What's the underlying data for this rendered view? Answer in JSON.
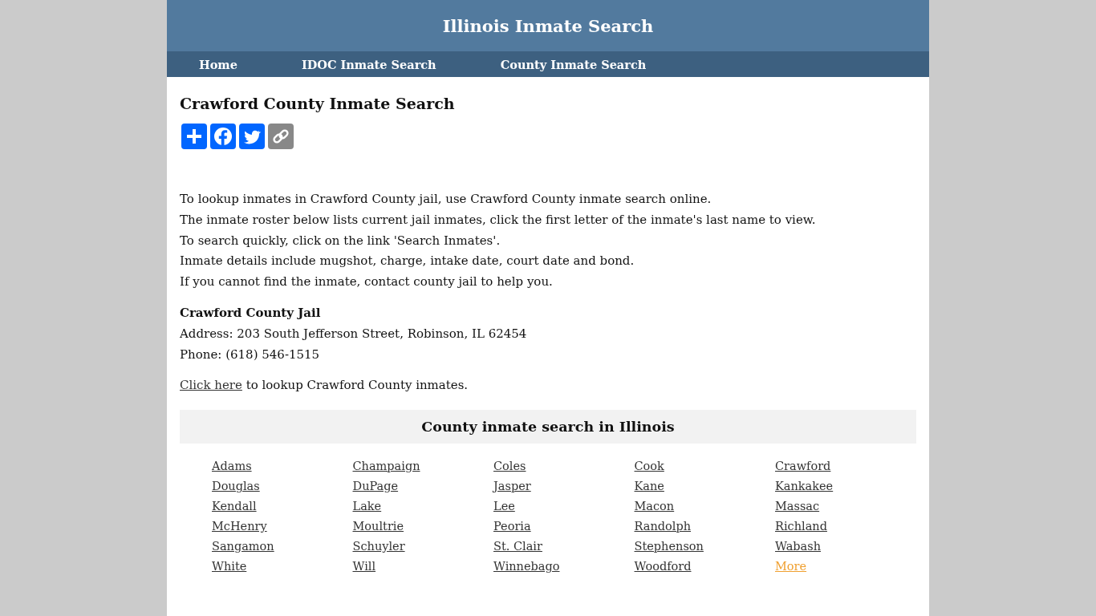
{
  "header": {
    "title": "Illinois Inmate Search"
  },
  "nav": [
    {
      "label": "Home"
    },
    {
      "label": "IDOC Inmate Search"
    },
    {
      "label": "County Inmate Search"
    }
  ],
  "heading": "Crawford County Inmate Search",
  "share_buttons": [
    {
      "kind": "share",
      "color": "#0166ff"
    },
    {
      "kind": "facebook",
      "color": "#0166ff"
    },
    {
      "kind": "twitter",
      "color": "#0166ff"
    },
    {
      "kind": "copy",
      "color": "#888888"
    }
  ],
  "intro": [
    "To lookup inmates in Crawford County jail, use Crawford County inmate search online.",
    "The inmate roster below lists current jail inmates, click the first letter of the inmate's last name to view.",
    "To search quickly, click on the link 'Search Inmates'.",
    "Inmate details include mugshot, charge, intake date, court date and bond.",
    "If you cannot find the inmate, contact county jail to help you."
  ],
  "jail": {
    "name": "Crawford County Jail",
    "address": "Address: 203 South Jefferson Street, Robinson, IL 62454",
    "phone": "Phone: (618) 546-1515"
  },
  "lookup": {
    "link": "Click here",
    "text": " to lookup Crawford County inmates."
  },
  "counties": {
    "title": "County inmate search in Illinois",
    "links": [
      {
        "label": "Adams",
        "kind": "county"
      },
      {
        "label": "Champaign",
        "kind": "county"
      },
      {
        "label": "Coles",
        "kind": "county"
      },
      {
        "label": "Cook",
        "kind": "county"
      },
      {
        "label": "Crawford",
        "kind": "county"
      },
      {
        "label": "Douglas",
        "kind": "county"
      },
      {
        "label": "DuPage",
        "kind": "county"
      },
      {
        "label": "Jasper",
        "kind": "county"
      },
      {
        "label": "Kane",
        "kind": "county"
      },
      {
        "label": "Kankakee",
        "kind": "county"
      },
      {
        "label": "Kendall",
        "kind": "county"
      },
      {
        "label": "Lake",
        "kind": "county"
      },
      {
        "label": "Lee",
        "kind": "county"
      },
      {
        "label": "Macon",
        "kind": "county"
      },
      {
        "label": "Massac",
        "kind": "county"
      },
      {
        "label": "McHenry",
        "kind": "county"
      },
      {
        "label": "Moultrie",
        "kind": "county"
      },
      {
        "label": "Peoria",
        "kind": "county"
      },
      {
        "label": "Randolph",
        "kind": "county"
      },
      {
        "label": "Richland",
        "kind": "county"
      },
      {
        "label": "Sangamon",
        "kind": "county"
      },
      {
        "label": "Schuyler",
        "kind": "county"
      },
      {
        "label": "St. Clair",
        "kind": "county"
      },
      {
        "label": "Stephenson",
        "kind": "county"
      },
      {
        "label": "Wabash",
        "kind": "county"
      },
      {
        "label": "White",
        "kind": "county"
      },
      {
        "label": "Will",
        "kind": "county"
      },
      {
        "label": "Winnebago",
        "kind": "county"
      },
      {
        "label": "Woodford",
        "kind": "county"
      },
      {
        "label": "More",
        "kind": "more"
      }
    ]
  }
}
